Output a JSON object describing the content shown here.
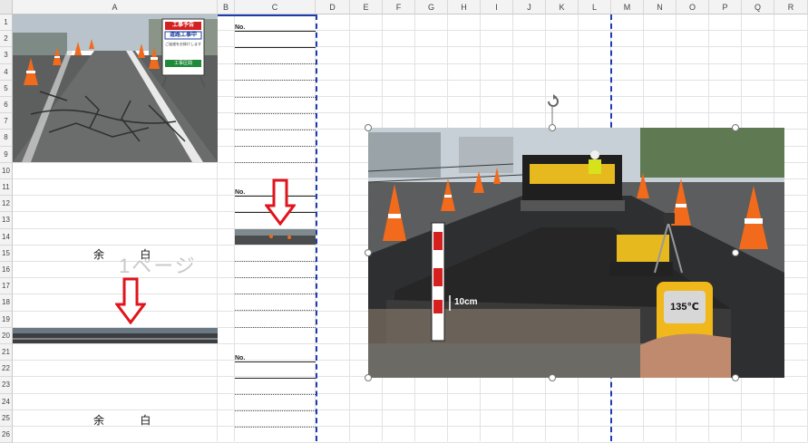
{
  "columns": [
    {
      "label": "A"
    },
    {
      "label": "B"
    },
    {
      "label": "C"
    },
    {
      "label": "D"
    },
    {
      "label": "E"
    },
    {
      "label": "F"
    },
    {
      "label": "G"
    },
    {
      "label": "H"
    },
    {
      "label": "I"
    },
    {
      "label": "J"
    },
    {
      "label": "K"
    },
    {
      "label": "L"
    },
    {
      "label": "M"
    },
    {
      "label": "N"
    },
    {
      "label": "O"
    },
    {
      "label": "P"
    },
    {
      "label": "Q"
    },
    {
      "label": "R"
    }
  ],
  "rows": [
    "1",
    "2",
    "3",
    "4",
    "5",
    "6",
    "7",
    "8",
    "9",
    "10",
    "11",
    "12",
    "13",
    "14",
    "15",
    "16",
    "17",
    "18",
    "19",
    "20",
    "21",
    "22",
    "23",
    "24",
    "25",
    "26"
  ],
  "blank_text_1": "余 白",
  "blank_text_2": "余 白",
  "page_watermark": "1ページ",
  "sign": {
    "line1": "工事予告",
    "line2": "道路工事中",
    "line3": "ご迷惑をお掛けします",
    "line4": "工事区間"
  },
  "measure_label": "10cm",
  "thermometer_reading": "135℃",
  "small_label_1": "No.",
  "small_label_2": "No.",
  "small_label_3": "No.",
  "colors": {
    "page_break": "#1f3bb3",
    "arrow": "#e0141c",
    "cone": "#f26a1b"
  }
}
